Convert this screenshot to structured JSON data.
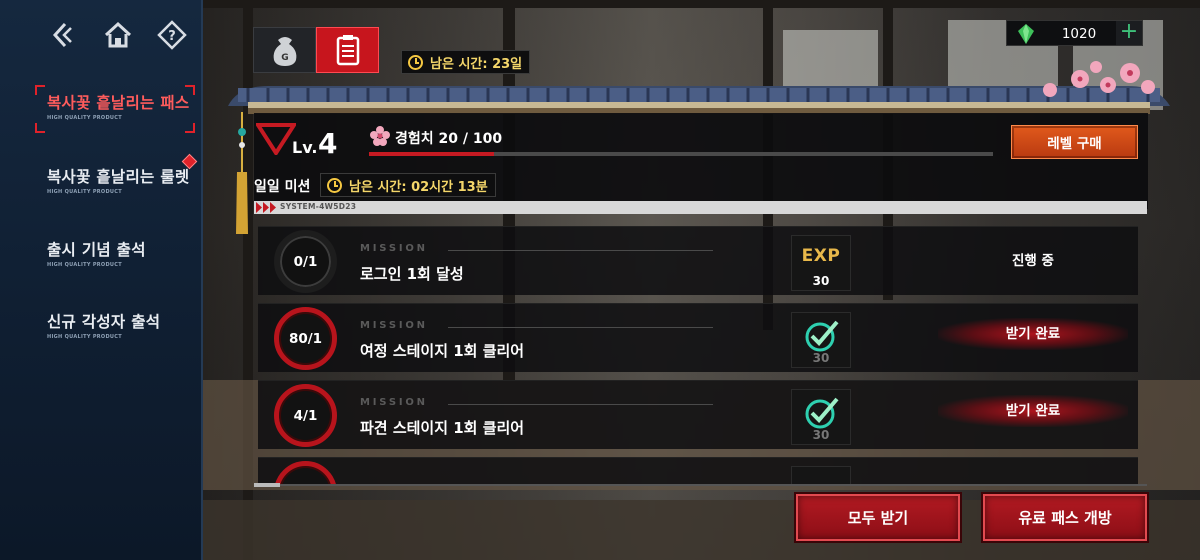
{
  "sidebar": {
    "nav": [
      "back-icon",
      "home-icon",
      "help-icon"
    ],
    "items": [
      {
        "title": "복사꽃 흩날리는 패스",
        "subtitle": "HIGH QUALITY PRODUCT",
        "active": true,
        "badge": false
      },
      {
        "title": "복사꽃 흩날리는 룰렛",
        "subtitle": "HIGH QUALITY PRODUCT",
        "active": false,
        "badge": true
      },
      {
        "title": "출시 기념 출석",
        "subtitle": "HIGH QUALITY PRODUCT",
        "active": false,
        "badge": false
      },
      {
        "title": "신규 각성자 출석",
        "subtitle": "HIGH QUALITY PRODUCT",
        "active": false,
        "badge": false
      }
    ]
  },
  "tabs": {
    "items": [
      {
        "icon": "money-bag-icon",
        "glyph": "G",
        "active": false
      },
      {
        "icon": "mission-board-icon",
        "active": true
      }
    ]
  },
  "pass_timer": {
    "label": "남은 시간: 23일"
  },
  "currency": {
    "icon": "green-gem-icon",
    "value": "1020",
    "plus": "+"
  },
  "level": {
    "prefix": "Lv.",
    "value": "4",
    "exp_label": "경험치 20 / 100",
    "exp_progress": 0.2,
    "buy_label": "레벨 구매"
  },
  "daily": {
    "label": "일일 미션",
    "timer": "남은 시간: 02시간 13분",
    "system_code": "SYSTEM-4W5D23"
  },
  "missions": [
    {
      "progress": "0/1",
      "tag": "MISSION",
      "name": "로그인 1회 달성",
      "reward_type": "EXP",
      "reward_value": "30",
      "status": "진행 중",
      "completed": false
    },
    {
      "progress": "80/1",
      "tag": "MISSION",
      "name": "여정 스테이지 1회 클리어",
      "reward_type": "check",
      "reward_value": "30",
      "status": "받기 완료",
      "completed": true
    },
    {
      "progress": "4/1",
      "tag": "MISSION",
      "name": "파견 스테이지 1회 클리어",
      "reward_type": "check",
      "reward_value": "30",
      "status": "받기 완료",
      "completed": true
    }
  ],
  "buttons": {
    "claim_all": "모두 받기",
    "open_paid": "유료 패스 개방"
  },
  "colors": {
    "accent_red": "#c51a22",
    "timer_yellow": "#f5c842",
    "buy_orange": "#d9521a",
    "sidebar_bg": "#12243a"
  }
}
